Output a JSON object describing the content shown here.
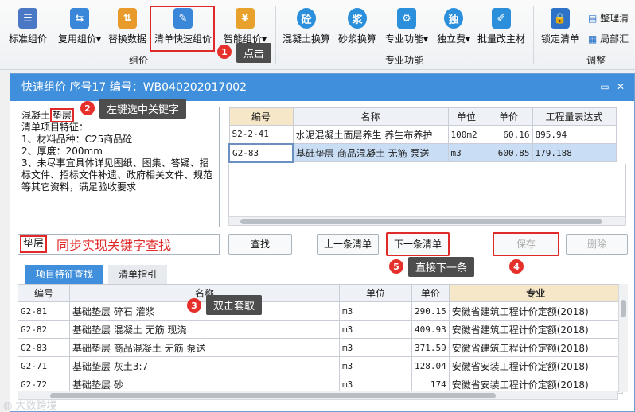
{
  "ribbon": {
    "buttons": [
      {
        "label": "标准组价",
        "icon": "grid-list-icon",
        "color": "#4a78c4"
      },
      {
        "label": "复用组价",
        "icon": "reuse-icon",
        "color": "#3a86d8",
        "has_dropdown": true
      },
      {
        "label": "替换数据",
        "icon": "replace-icon",
        "color": "#e89a2a"
      },
      {
        "label": "清单快速组价",
        "icon": "quick-price-icon",
        "color": "#3a86d8"
      },
      {
        "label": "智能组价",
        "icon": "smart-price-icon",
        "color": "#e8a12a",
        "has_dropdown": true
      },
      {
        "label": "混凝土换算",
        "icon": "concrete-convert-icon",
        "color": "#2b8fdc",
        "glyph": "砼"
      },
      {
        "label": "砂浆换算",
        "icon": "mortar-convert-icon",
        "color": "#2b8fdc",
        "glyph": "浆"
      },
      {
        "label": "专业功能",
        "icon": "professional-function-icon",
        "color": "#2b8fdc",
        "has_dropdown": true
      },
      {
        "label": "独立费",
        "icon": "independent-fee-icon",
        "color": "#2b8fdc",
        "glyph": "独",
        "has_dropdown": true
      },
      {
        "label": "批量改主材",
        "icon": "batch-material-icon",
        "color": "#2b8fdc"
      },
      {
        "label": "锁定清单",
        "icon": "lock-icon",
        "color": "#2b72c8"
      }
    ],
    "side_items": [
      {
        "label": "整理清",
        "icon": "organize-list-icon"
      },
      {
        "label": "局部汇",
        "icon": "partial-summary-icon"
      }
    ],
    "groups": [
      "组价",
      "专业功能",
      "调整"
    ]
  },
  "annotations": {
    "step1": {
      "num": "1",
      "text": "点击"
    },
    "step2": {
      "num": "2",
      "text": "左键选中关键字"
    },
    "step3": {
      "num": "3",
      "text": "双击套取"
    },
    "step4": {
      "num": "4"
    },
    "step5": {
      "num": "5",
      "text": "直接下一条"
    },
    "sync_text": "同步实现关键字查找"
  },
  "dialog": {
    "title": "快速组价 序号17 编号：WB040202017002",
    "clause_before": "混凝土",
    "clause_keyword": "垫层",
    "clause_after": "\n清单项目特征：\n1、材料品种：C25商品砼\n2、厚度：200mm\n3、未尽事宜具体详见图纸、图集、答疑、招标文件、招标文件补遗、政府相关文件、规范等其它资料，满足验收要求",
    "upper_headers": [
      "编号",
      "名称",
      "单位",
      "单价",
      "工程量表达式"
    ],
    "upper_rows": [
      {
        "code": "S2-2-41",
        "name": "水泥混凝土面层养生 养生布养护",
        "unit": "100m2",
        "price": "60.16",
        "expr": "895.94"
      },
      {
        "code": "G2-83",
        "name": "基础垫层 商品混凝土 无筋 泵送",
        "unit": "m3",
        "price": "600.85",
        "expr": "179.188"
      }
    ],
    "search_value": "垫层",
    "buttons": {
      "find": "查找",
      "prev": "上一条清单",
      "next": "下一条清单",
      "save": "保存",
      "delete": "删除"
    },
    "tabs": [
      "项目特征查找",
      "清单指引"
    ],
    "lower_headers": [
      "编号",
      "名称",
      "单位",
      "单价",
      "专业"
    ],
    "lower_rows": [
      {
        "code": "G2-81",
        "name": "基础垫层 碎石 灌浆",
        "unit": "m3",
        "price": "290.15",
        "spec": "安徽省建筑工程计价定额(2018)"
      },
      {
        "code": "G2-82",
        "name": "基础垫层 混凝土 无筋 现浇",
        "unit": "m3",
        "price": "409.93",
        "spec": "安徽省建筑工程计价定额(2018)"
      },
      {
        "code": "G2-83",
        "name": "基础垫层 商品混凝土 无筋 泵送",
        "unit": "m3",
        "price": "371.59",
        "spec": "安徽省建筑工程计价定额(2018)"
      },
      {
        "code": "G2-71",
        "name": "基础垫层 灰土3:7",
        "unit": "m3",
        "price": "128.04",
        "spec": "安徽省安装工程计价定额(2018)"
      },
      {
        "code": "G2-72",
        "name": "基础垫层 砂",
        "unit": "m3",
        "price": "174",
        "spec": "安徽省安装工程计价定额(2018)"
      }
    ]
  },
  "watermark": "大数跨境"
}
